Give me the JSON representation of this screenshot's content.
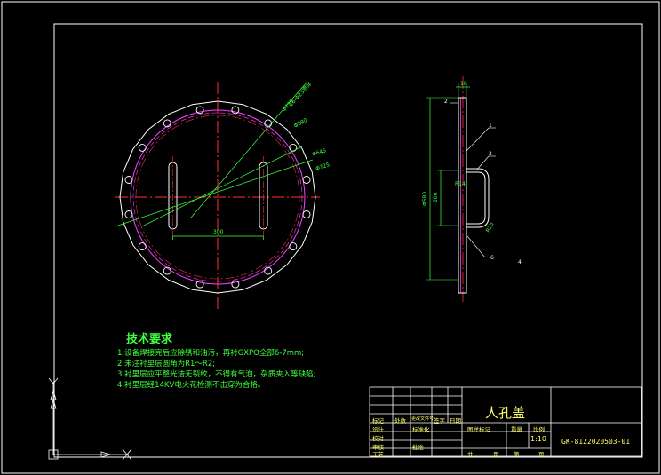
{
  "drawing": {
    "title": "人孔盖",
    "drawing_no": "GK-8122020503-01",
    "scale": "1:10",
    "tech_requirements": {
      "title": "技术要求",
      "items": [
        "1.设备焊接完后应除锈和油污，再衬GXPO全部6-7mm;",
        "2.未注衬里层圆角为R1～R2;",
        "3.衬里层应平整光洁无裂纹，不得有气泡，杂质夹入等缺陷;",
        "4.衬里层经14KV电火花检测不击穿为合格。"
      ]
    },
    "dimensions": {
      "bolt_holes": "16-Φ23贯穿",
      "bolt_circle": "Φ890",
      "pcd_note": "Φ645",
      "outer_ref": "Φ725",
      "inner_ref": "Φ725",
      "handle_spacing": "300",
      "overall_height": "Φ580",
      "handle_height": "200",
      "plate_thickness": "18",
      "handle_depth": "R14",
      "handle_radius": "R23",
      "weld_note": "4"
    },
    "part_labels": [
      "1",
      "2",
      "2",
      "6"
    ],
    "title_block": {
      "labels": [
        "标记",
        "处数",
        "更改文件号",
        "签字",
        "日期",
        "设计",
        "校对",
        "审核",
        "工艺",
        "标准化",
        "批准",
        "图样标记",
        "重量",
        "比例",
        "共",
        "页",
        "第",
        "页"
      ]
    }
  }
}
